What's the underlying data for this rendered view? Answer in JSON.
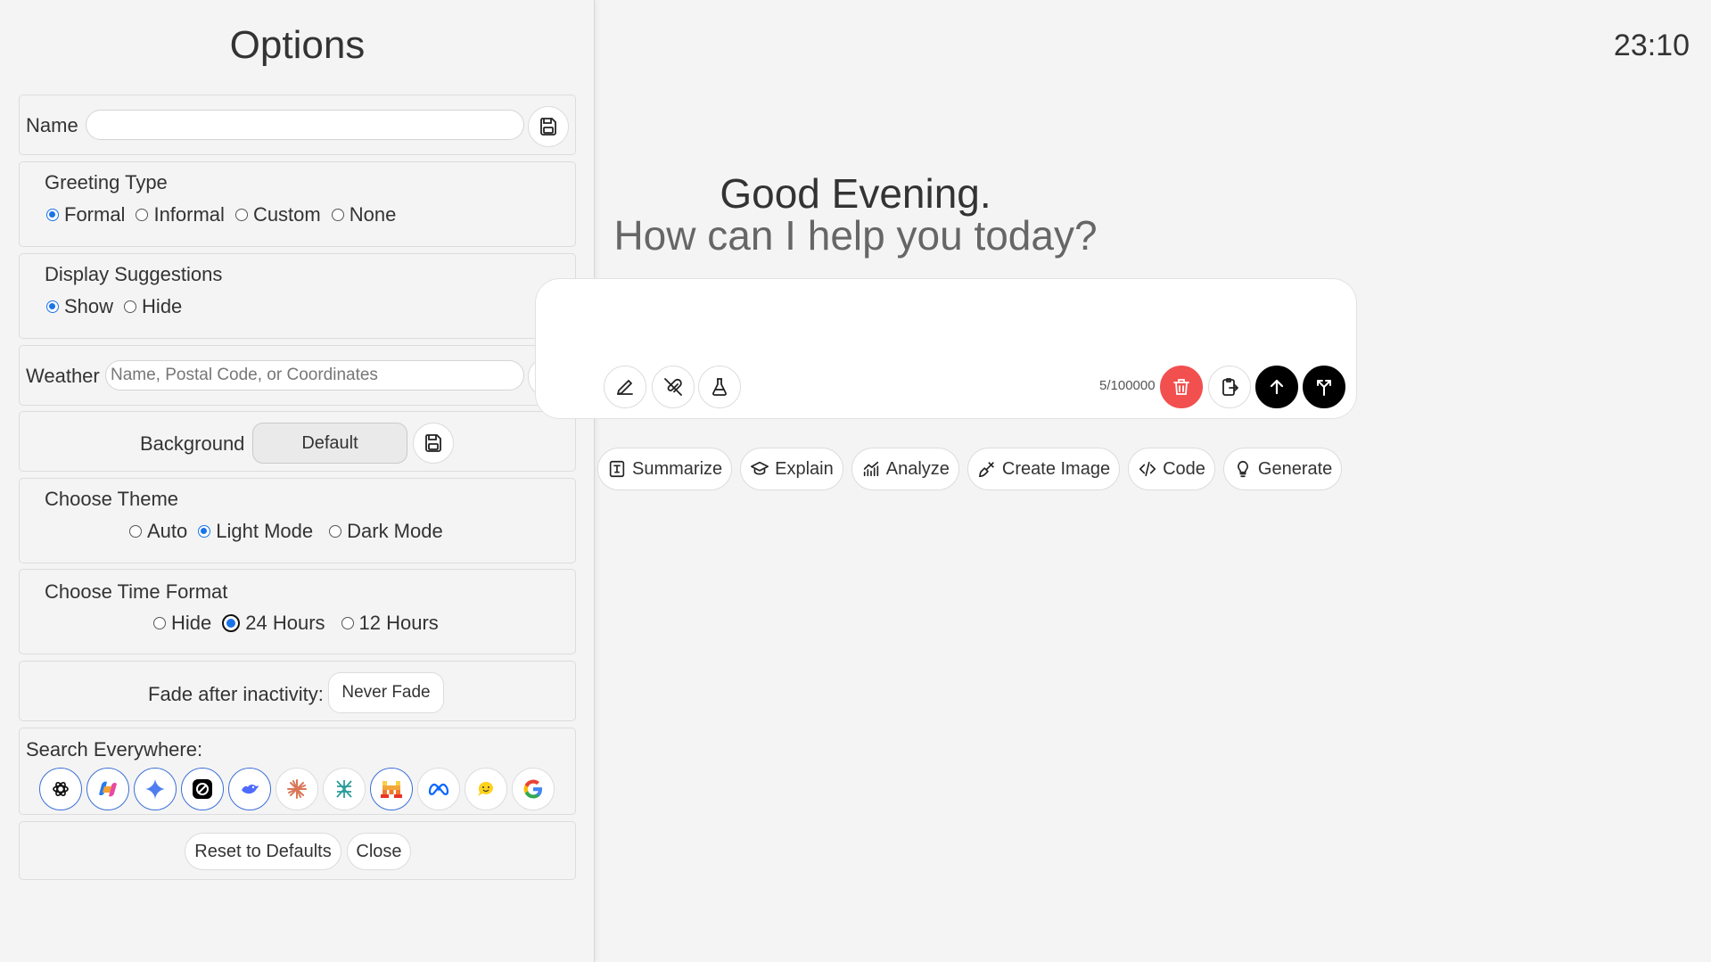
{
  "options": {
    "title": "Options",
    "name": {
      "label": "Name",
      "value": "",
      "placeholder": ""
    },
    "greeting_type": {
      "title": "Greeting Type",
      "options": [
        "Formal",
        "Informal",
        "Custom",
        "None"
      ],
      "selected": "Formal"
    },
    "display_suggestions": {
      "title": "Display Suggestions",
      "options": [
        "Show",
        "Hide"
      ],
      "selected": "Show"
    },
    "weather": {
      "label": "Weather",
      "value": "",
      "placeholder": "Name, Postal Code, or Coordinates"
    },
    "background": {
      "label": "Background",
      "button": "Default"
    },
    "theme": {
      "title": "Choose Theme",
      "options": [
        "Auto",
        "Light Mode",
        "Dark Mode"
      ],
      "selected": "Light Mode"
    },
    "time_format": {
      "title": "Choose Time Format",
      "options": [
        "Hide",
        "24 Hours",
        "12 Hours"
      ],
      "selected": "24 Hours"
    },
    "fade": {
      "label": "Fade after inactivity:",
      "button": "Never Fade"
    },
    "search_everywhere": {
      "label": "Search Everywhere:",
      "engines": [
        "chatgpt-icon",
        "copilot-icon",
        "gemini-icon",
        "perplexity-icon",
        "deepseek-icon",
        "claude-icon",
        "grok-icon",
        "mistral-icon",
        "meta-ai-icon",
        "huggingchat-icon",
        "google-icon"
      ]
    },
    "reset_label": "Reset to Defaults",
    "close_label": "Close"
  },
  "clock": "23:10",
  "greeting": {
    "line1": "Good Evening.",
    "line2": "How can I help you today?"
  },
  "chat": {
    "char_count": "5/100000"
  },
  "suggestions": [
    "Summarize",
    "Explain",
    "Analyze",
    "Create Image",
    "Code",
    "Generate"
  ],
  "colors": {
    "accent": "#1a73e8",
    "delete": "#f24f4f",
    "send": "#000000"
  }
}
